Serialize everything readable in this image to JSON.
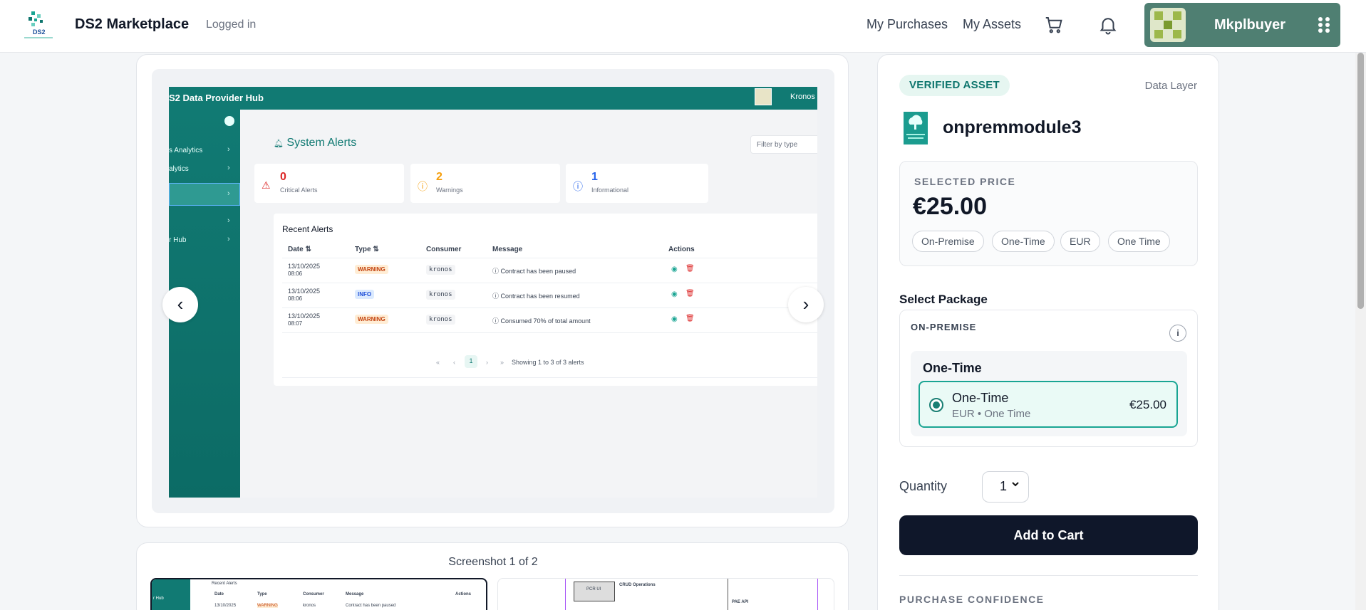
{
  "header": {
    "brand": "DS2 Marketplace",
    "status": "Logged in",
    "nav": [
      "My Purchases",
      "My Assets"
    ],
    "username": "Mkplbuyer",
    "logo_text": "DS2"
  },
  "gallery": {
    "screenshot": {
      "app_title": "S2 Data Provider Hub",
      "user": "Kronos",
      "sidebar": [
        "s Analytics",
        "alytics",
        "",
        "",
        "r Hub"
      ],
      "page_title": "System Alerts",
      "filter_placeholder": "Filter by type",
      "stats": [
        {
          "value": "0",
          "label": "Critical Alerts",
          "color": "#dc2626"
        },
        {
          "value": "2",
          "label": "Warnings",
          "color": "#f59e0b"
        },
        {
          "value": "1",
          "label": "Informational",
          "color": "#2563eb"
        }
      ],
      "table_title": "Recent Alerts",
      "columns": [
        "Date ⇅",
        "Type ⇅",
        "Consumer",
        "Message",
        "Actions"
      ],
      "rows": [
        {
          "date": "13/10/2025",
          "time": "08:06",
          "type": "WARNING",
          "consumer": "kronos",
          "message": "Contract has been paused"
        },
        {
          "date": "13/10/2025",
          "time": "08:06",
          "type": "INFO",
          "consumer": "kronos",
          "message": "Contract has been resumed"
        },
        {
          "date": "13/10/2025",
          "time": "08:07",
          "type": "WARNING",
          "consumer": "kronos",
          "message": "Consumed 70% of total amount"
        }
      ],
      "pager_page": "1",
      "pager_text": "Showing 1 to 3 of 3 alerts"
    },
    "caption": "Screenshot 1 of 2",
    "thumb1": {
      "title": "Recent Alerts",
      "cols": [
        "Date",
        "Type",
        "Consumer",
        "Message",
        "Actions"
      ],
      "side": "r Hub",
      "date": "13/10/2025",
      "badge": "WARNING",
      "consumer": "kronos",
      "message": "Contract has been paused"
    },
    "thumb2": {
      "box": "PCR UI",
      "label": "CRUD Operations",
      "api": "PAE API"
    }
  },
  "asset": {
    "badge": "VERIFIED ASSET",
    "layer": "Data Layer",
    "name": "onpremmodule3",
    "price_label": "SELECTED PRICE",
    "price": "€25.00",
    "chips": [
      "On-Premise",
      "One-Time",
      "EUR",
      "One Time"
    ],
    "select_package_label": "Select Package",
    "package_group": "ON-PREMISE",
    "info_label": "i",
    "package_name": "One-Time",
    "option": {
      "name": "One-Time",
      "sub": "EUR • One Time",
      "price": "€25.00"
    },
    "quantity_label": "Quantity",
    "quantity": "1",
    "add_to_cart": "Add to Cart",
    "confidence_label": "PURCHASE CONFIDENCE"
  },
  "colors": {
    "accent": "#117a73",
    "user_box": "#4f7f72",
    "cart_button": "#0f172a",
    "option_border": "#1aa593"
  }
}
